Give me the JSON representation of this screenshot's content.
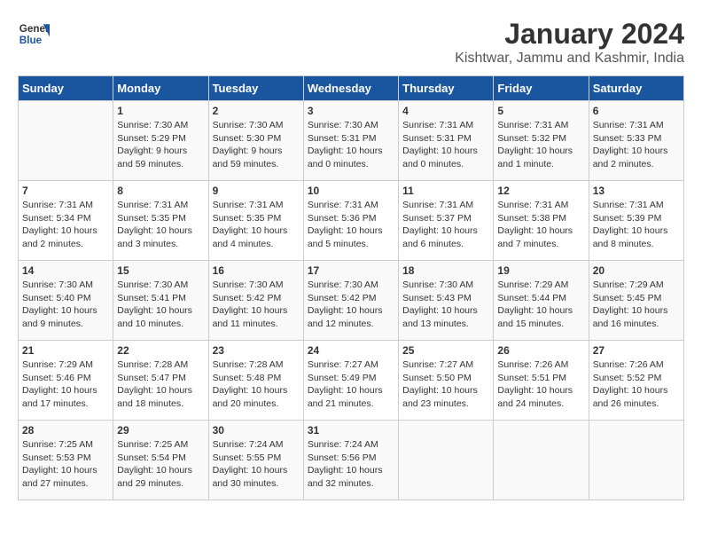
{
  "header": {
    "logo_general": "General",
    "logo_blue": "Blue",
    "month": "January 2024",
    "location": "Kishtwar, Jammu and Kashmir, India"
  },
  "days_of_week": [
    "Sunday",
    "Monday",
    "Tuesday",
    "Wednesday",
    "Thursday",
    "Friday",
    "Saturday"
  ],
  "weeks": [
    [
      {
        "day": "",
        "content": ""
      },
      {
        "day": "1",
        "content": "Sunrise: 7:30 AM\nSunset: 5:29 PM\nDaylight: 9 hours\nand 59 minutes."
      },
      {
        "day": "2",
        "content": "Sunrise: 7:30 AM\nSunset: 5:30 PM\nDaylight: 9 hours\nand 59 minutes."
      },
      {
        "day": "3",
        "content": "Sunrise: 7:30 AM\nSunset: 5:31 PM\nDaylight: 10 hours\nand 0 minutes."
      },
      {
        "day": "4",
        "content": "Sunrise: 7:31 AM\nSunset: 5:31 PM\nDaylight: 10 hours\nand 0 minutes."
      },
      {
        "day": "5",
        "content": "Sunrise: 7:31 AM\nSunset: 5:32 PM\nDaylight: 10 hours\nand 1 minute."
      },
      {
        "day": "6",
        "content": "Sunrise: 7:31 AM\nSunset: 5:33 PM\nDaylight: 10 hours\nand 2 minutes."
      }
    ],
    [
      {
        "day": "7",
        "content": "Sunrise: 7:31 AM\nSunset: 5:34 PM\nDaylight: 10 hours\nand 2 minutes."
      },
      {
        "day": "8",
        "content": "Sunrise: 7:31 AM\nSunset: 5:35 PM\nDaylight: 10 hours\nand 3 minutes."
      },
      {
        "day": "9",
        "content": "Sunrise: 7:31 AM\nSunset: 5:35 PM\nDaylight: 10 hours\nand 4 minutes."
      },
      {
        "day": "10",
        "content": "Sunrise: 7:31 AM\nSunset: 5:36 PM\nDaylight: 10 hours\nand 5 minutes."
      },
      {
        "day": "11",
        "content": "Sunrise: 7:31 AM\nSunset: 5:37 PM\nDaylight: 10 hours\nand 6 minutes."
      },
      {
        "day": "12",
        "content": "Sunrise: 7:31 AM\nSunset: 5:38 PM\nDaylight: 10 hours\nand 7 minutes."
      },
      {
        "day": "13",
        "content": "Sunrise: 7:31 AM\nSunset: 5:39 PM\nDaylight: 10 hours\nand 8 minutes."
      }
    ],
    [
      {
        "day": "14",
        "content": "Sunrise: 7:30 AM\nSunset: 5:40 PM\nDaylight: 10 hours\nand 9 minutes."
      },
      {
        "day": "15",
        "content": "Sunrise: 7:30 AM\nSunset: 5:41 PM\nDaylight: 10 hours\nand 10 minutes."
      },
      {
        "day": "16",
        "content": "Sunrise: 7:30 AM\nSunset: 5:42 PM\nDaylight: 10 hours\nand 11 minutes."
      },
      {
        "day": "17",
        "content": "Sunrise: 7:30 AM\nSunset: 5:42 PM\nDaylight: 10 hours\nand 12 minutes."
      },
      {
        "day": "18",
        "content": "Sunrise: 7:30 AM\nSunset: 5:43 PM\nDaylight: 10 hours\nand 13 minutes."
      },
      {
        "day": "19",
        "content": "Sunrise: 7:29 AM\nSunset: 5:44 PM\nDaylight: 10 hours\nand 15 minutes."
      },
      {
        "day": "20",
        "content": "Sunrise: 7:29 AM\nSunset: 5:45 PM\nDaylight: 10 hours\nand 16 minutes."
      }
    ],
    [
      {
        "day": "21",
        "content": "Sunrise: 7:29 AM\nSunset: 5:46 PM\nDaylight: 10 hours\nand 17 minutes."
      },
      {
        "day": "22",
        "content": "Sunrise: 7:28 AM\nSunset: 5:47 PM\nDaylight: 10 hours\nand 18 minutes."
      },
      {
        "day": "23",
        "content": "Sunrise: 7:28 AM\nSunset: 5:48 PM\nDaylight: 10 hours\nand 20 minutes."
      },
      {
        "day": "24",
        "content": "Sunrise: 7:27 AM\nSunset: 5:49 PM\nDaylight: 10 hours\nand 21 minutes."
      },
      {
        "day": "25",
        "content": "Sunrise: 7:27 AM\nSunset: 5:50 PM\nDaylight: 10 hours\nand 23 minutes."
      },
      {
        "day": "26",
        "content": "Sunrise: 7:26 AM\nSunset: 5:51 PM\nDaylight: 10 hours\nand 24 minutes."
      },
      {
        "day": "27",
        "content": "Sunrise: 7:26 AM\nSunset: 5:52 PM\nDaylight: 10 hours\nand 26 minutes."
      }
    ],
    [
      {
        "day": "28",
        "content": "Sunrise: 7:25 AM\nSunset: 5:53 PM\nDaylight: 10 hours\nand 27 minutes."
      },
      {
        "day": "29",
        "content": "Sunrise: 7:25 AM\nSunset: 5:54 PM\nDaylight: 10 hours\nand 29 minutes."
      },
      {
        "day": "30",
        "content": "Sunrise: 7:24 AM\nSunset: 5:55 PM\nDaylight: 10 hours\nand 30 minutes."
      },
      {
        "day": "31",
        "content": "Sunrise: 7:24 AM\nSunset: 5:56 PM\nDaylight: 10 hours\nand 32 minutes."
      },
      {
        "day": "",
        "content": ""
      },
      {
        "day": "",
        "content": ""
      },
      {
        "day": "",
        "content": ""
      }
    ]
  ]
}
